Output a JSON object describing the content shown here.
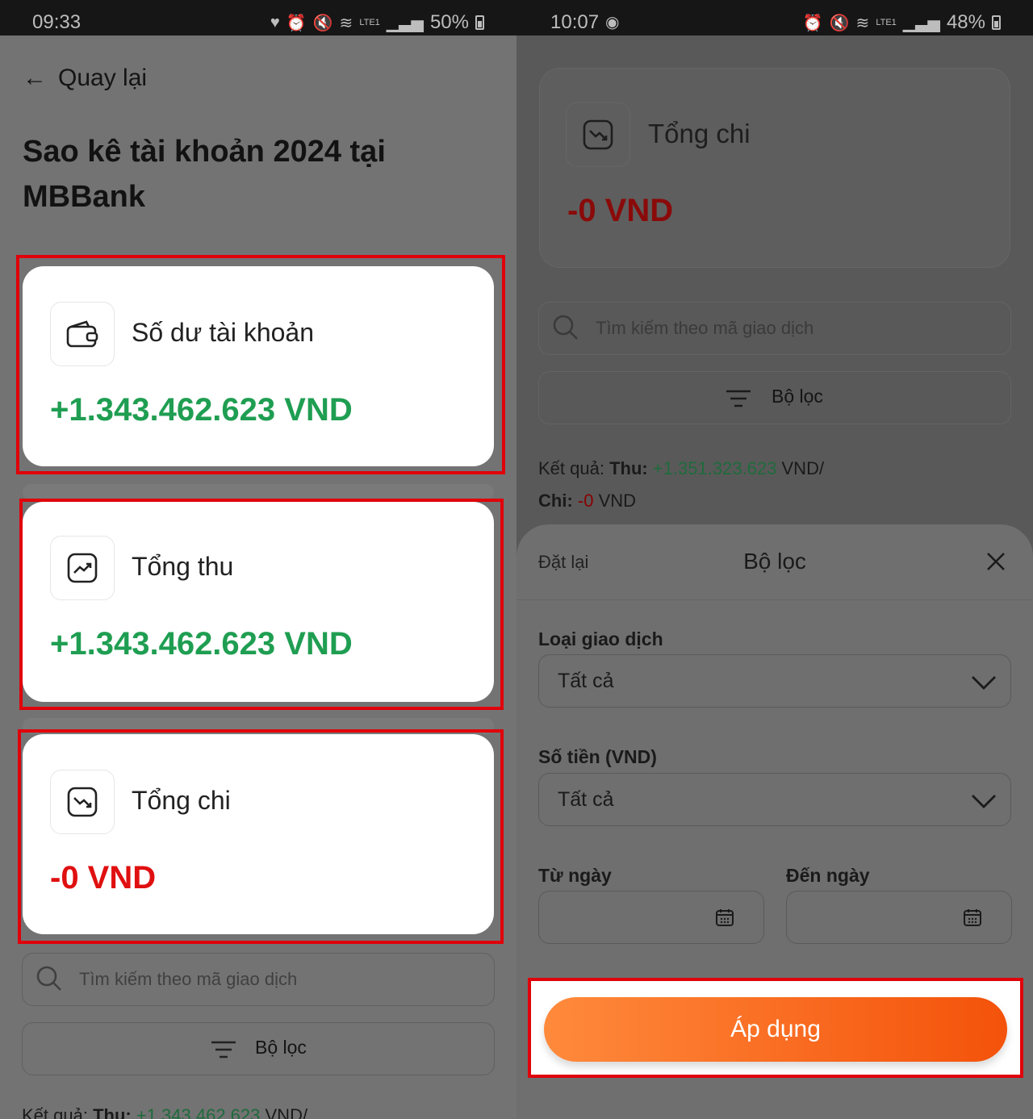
{
  "left": {
    "status": {
      "time": "09:33",
      "battery": "50%",
      "lte": "LTE1"
    },
    "back_label": "Quay lại",
    "page_title": "Sao kê tài khoản 2024 tại MBBank",
    "cards": [
      {
        "label": "Số dư tài khoản",
        "amount": "+1.343.462.623 VND",
        "icon": "wallet-icon"
      },
      {
        "label": "Tổng thu",
        "amount": "+1.343.462.623 VND",
        "icon": "trend-up-icon"
      },
      {
        "label": "Tổng chi",
        "amount": "-0 VND",
        "icon": "trend-down-icon"
      }
    ],
    "search_placeholder": "Tìm kiếm theo mã giao dịch",
    "filter_label": "Bộ lọc",
    "result": {
      "prefix": "Kết quả: ",
      "thu_label": "Thu: ",
      "thu_value": "+1.343.462.623",
      "suffix": " VND/"
    }
  },
  "right": {
    "status": {
      "time": "10:07",
      "battery": "48%",
      "lte": "LTE1"
    },
    "card": {
      "label": "Tổng chi",
      "amount": "-0 VND",
      "icon": "trend-down-icon"
    },
    "search_placeholder": "Tìm kiếm theo mã giao dịch",
    "filter_label": "Bộ lọc",
    "result": {
      "prefix": "Kết quả: ",
      "thu_label": "Thu: ",
      "thu_value": "+1.351.323.623",
      "suffix": " VND/",
      "chi_label": "Chi: ",
      "chi_value": "-0",
      "chi_suffix": " VND"
    },
    "sheet": {
      "reset": "Đặt lại",
      "title": "Bộ lọc",
      "type_label": "Loại giao dịch",
      "type_value": "Tất cả",
      "amount_label": "Số tiền (VND)",
      "amount_value": "Tất cả",
      "from_label": "Từ ngày",
      "to_label": "Đến ngày",
      "apply": "Áp dụng"
    }
  },
  "colors": {
    "green": "#1f9e52",
    "red": "#e01010",
    "highlight": "#e0000a",
    "apply_start": "#ff8a3c",
    "apply_end": "#f4520a"
  }
}
